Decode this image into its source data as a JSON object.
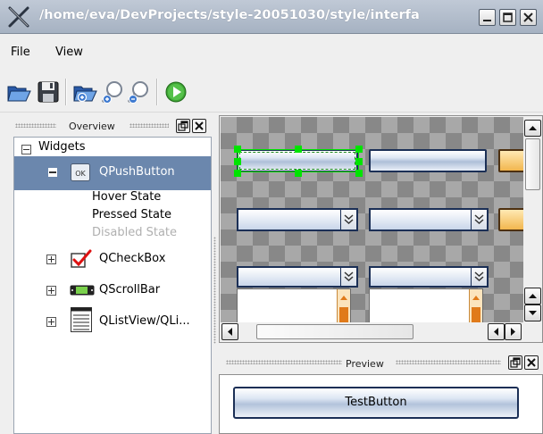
{
  "window": {
    "title": "/home/eva/DevProjects/style-20051030/style/interfa",
    "controls": [
      "minimize-icon",
      "maximize-icon",
      "close-icon"
    ]
  },
  "menu": {
    "items": [
      "File",
      "View"
    ]
  },
  "toolbar": {
    "tools": [
      "open-folder-icon",
      "save-icon",
      "open-file-icon",
      "zoom-in-icon",
      "zoom-out-icon",
      "run-icon"
    ]
  },
  "overview": {
    "title": "Overview",
    "tree": {
      "root": "Widgets",
      "items": [
        {
          "label": "QPushButton",
          "icon": "push-button-icon",
          "expanded": true,
          "selected": true,
          "states": [
            "Hover State",
            "Pressed State",
            "Disabled State"
          ]
        },
        {
          "label": "QCheckBox",
          "icon": "checkbox-icon",
          "expanded": false
        },
        {
          "label": "QScrollBar",
          "icon": "scrollbar-icon",
          "expanded": false
        },
        {
          "label": "QListView/QLi...",
          "icon": "list-view-icon",
          "expanded": false
        }
      ]
    }
  },
  "preview": {
    "title": "Preview",
    "button_label": "TestButton"
  },
  "colors": {
    "selection": "#6b87ad",
    "button_border": "#1b2f56",
    "selection_handle": "#00e400",
    "accent_orange": "#f2b64e"
  }
}
